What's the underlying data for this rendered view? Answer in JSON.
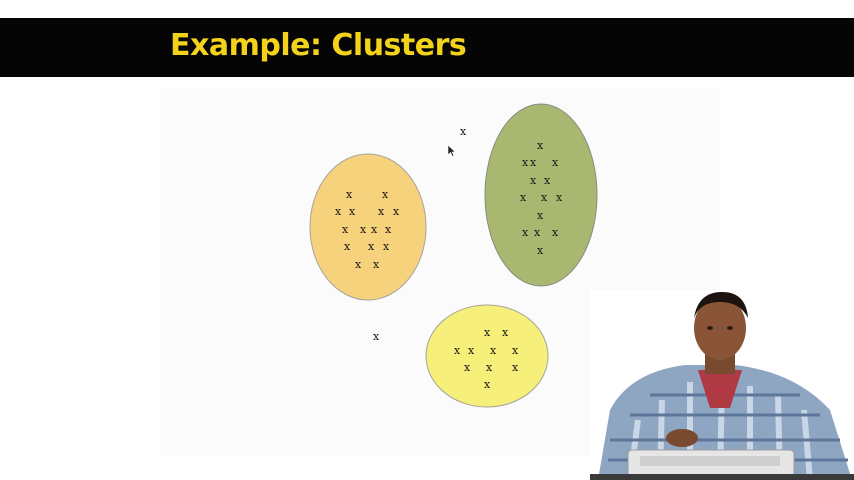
{
  "slide": {
    "title": "Example: Clusters"
  },
  "colors": {
    "title_bar": "#050505",
    "title_text": "#f2d21a",
    "cluster_orange": "#f7d27c",
    "cluster_green": "#a9b870",
    "cluster_yellow": "#f6ef7a"
  },
  "point_marker": "x",
  "clusters": [
    {
      "name": "orange-cluster",
      "rows": [
        "x      x",
        "x x    x x",
        "x  x x x",
        "x   x x",
        "x x"
      ]
    },
    {
      "name": "green-cluster",
      "rows": [
        "x",
        "xx  x",
        "x x",
        "x  x  x",
        "x",
        "x x  x",
        "x"
      ]
    },
    {
      "name": "yellow-cluster",
      "rows": [
        "x  x",
        "x x  x  x",
        "x  x  x",
        "x"
      ]
    }
  ],
  "outliers": [
    "x",
    "x"
  ],
  "icons": [
    "mouse-cursor-icon"
  ]
}
